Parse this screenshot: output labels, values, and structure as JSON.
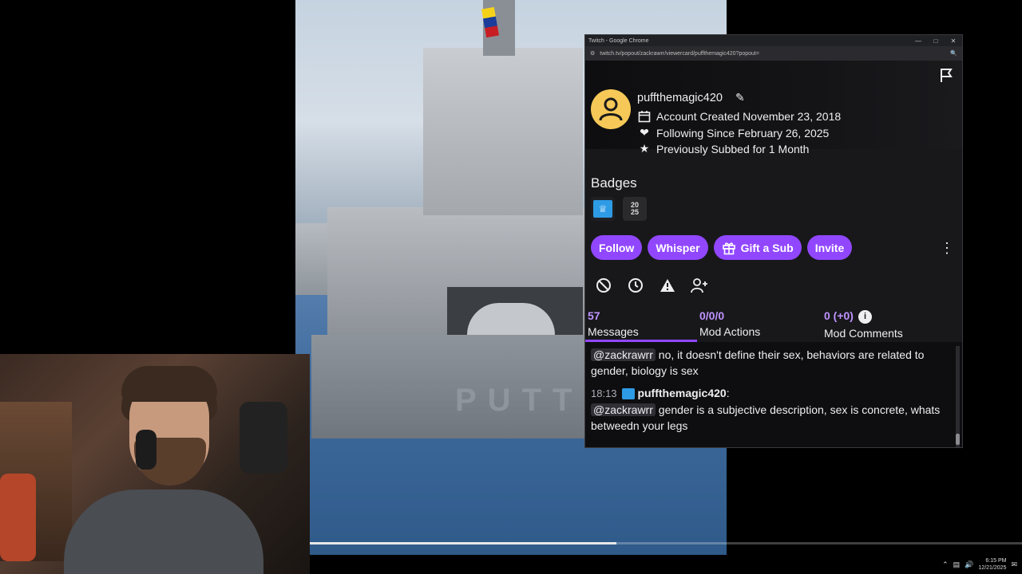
{
  "window": {
    "title": "Twitch - Google Chrome",
    "url": "twitch.tv/popout/zackrawrr/viewercard/puffthemagic420?popout="
  },
  "user": {
    "username": "puffthemagic420",
    "account_created": "Account Created November 23, 2018",
    "following_since": "Following Since February 26, 2025",
    "previously_subbed": "Previously Subbed for 1 Month"
  },
  "badges": {
    "title": "Badges",
    "year_badge": "2025"
  },
  "actions": {
    "follow": "Follow",
    "whisper": "Whisper",
    "gift_sub": "Gift a Sub",
    "invite": "Invite"
  },
  "mod_icons": [
    "ban-icon",
    "timeout-icon",
    "warn-icon",
    "add-mod-icon"
  ],
  "stats": {
    "messages_count": "57",
    "messages_label": "Messages",
    "mod_actions_count": "0/0/0",
    "mod_actions_label": "Mod Actions",
    "mod_comments_count": "0 (+0)",
    "mod_comments_label": "Mod Comments"
  },
  "chat": [
    {
      "mention": "@zackrawrr",
      "text": " no, it doesn't define their sex, behaviors are related to gender, biology is sex"
    },
    {
      "time": "18:13",
      "user": "puffthemagic420",
      "mention": "@zackrawrr",
      "text": " gender is a subjective description, sex is concrete, whats betweedn your legs"
    }
  ],
  "video": {
    "hull_text": "PUTT",
    "progress": 0.43
  },
  "tray": {
    "time": "6:15 PM",
    "date": "12/21/2025"
  },
  "colors": {
    "accent": "#9147ff",
    "accent_text": "#bf94ff",
    "avatar": "#f5c857",
    "sub_badge": "#2e9be6"
  }
}
